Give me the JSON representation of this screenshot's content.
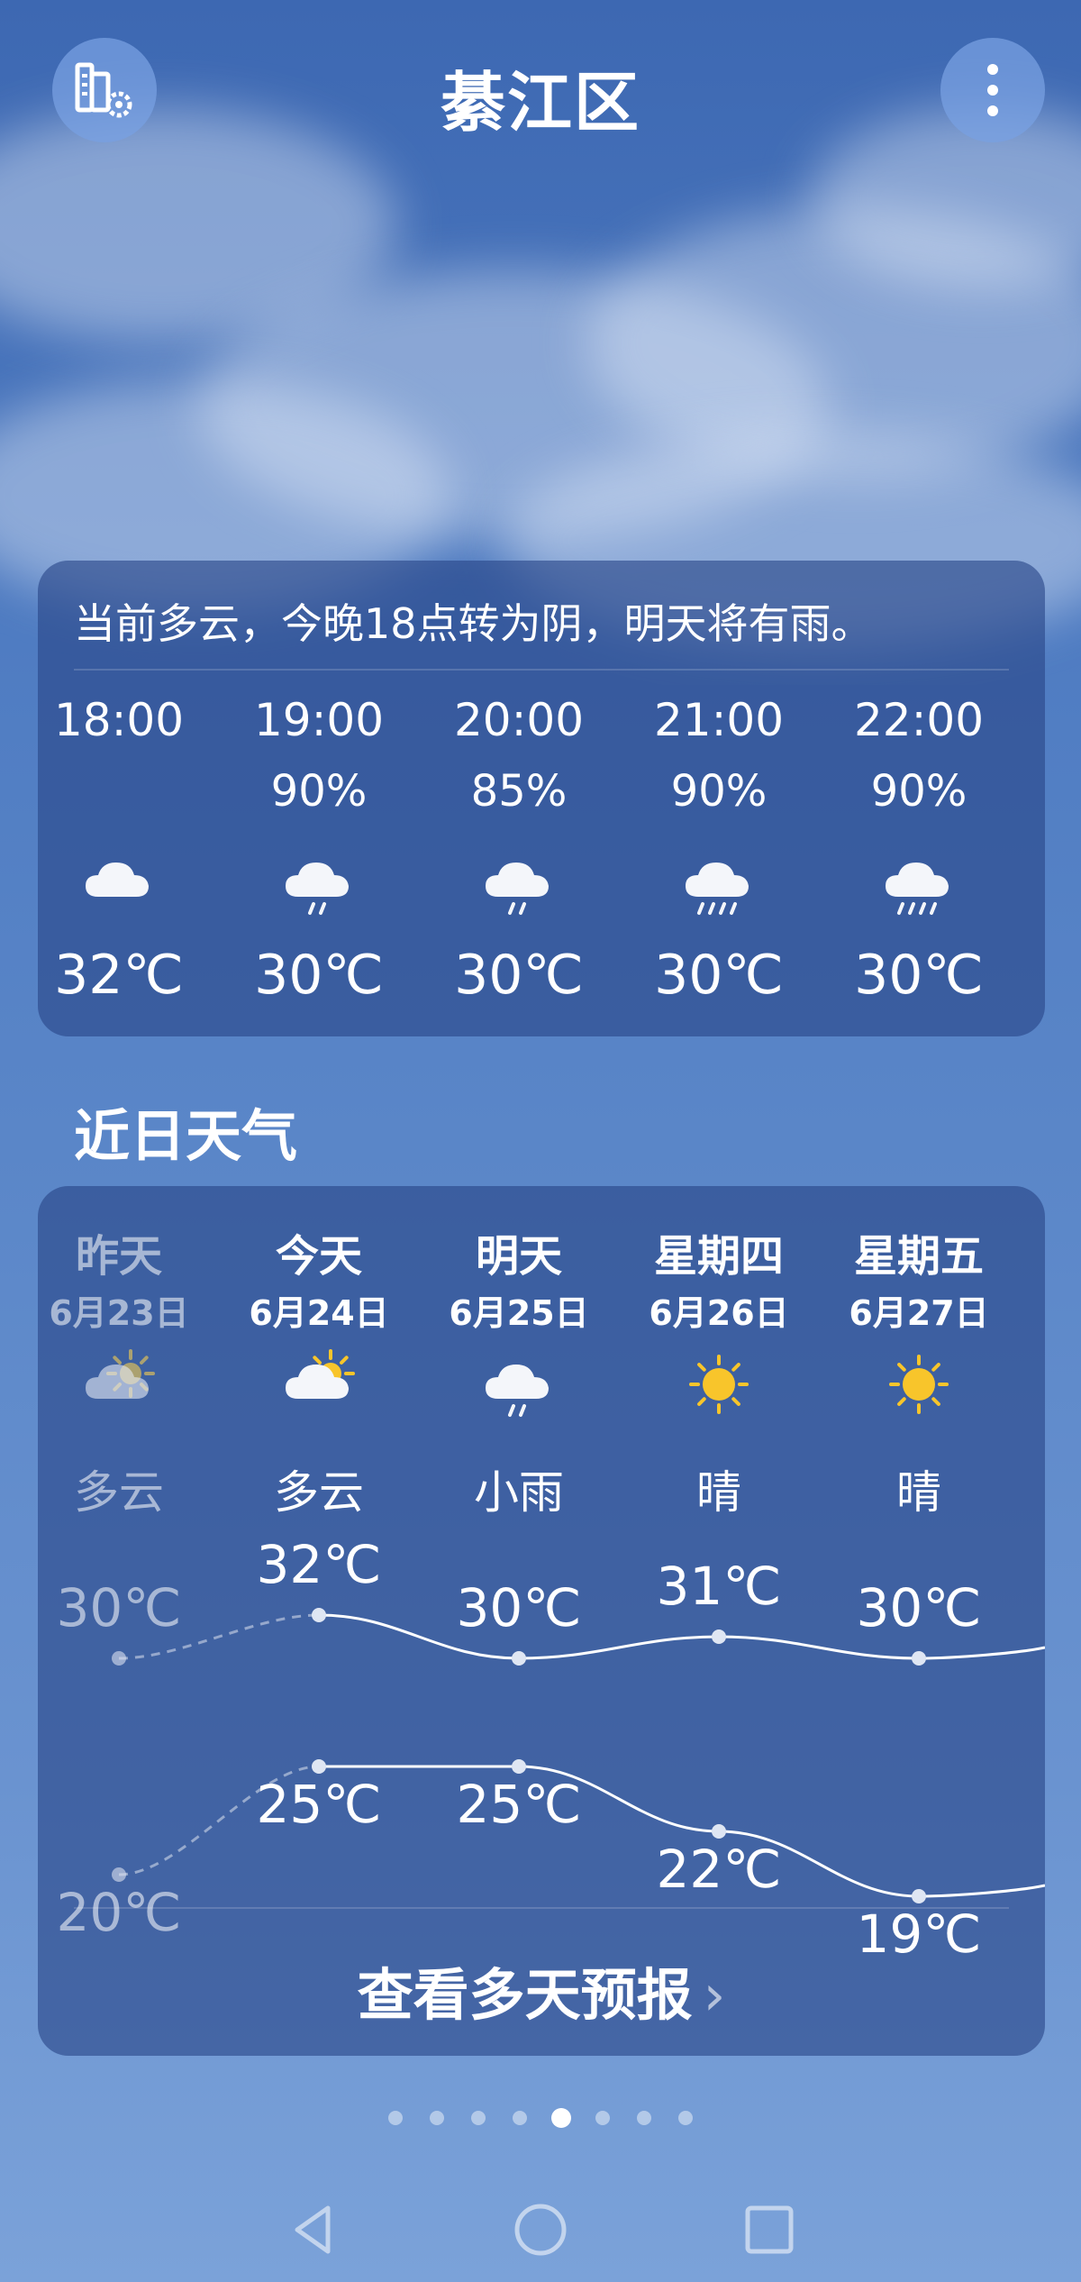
{
  "header": {
    "city": "綦江区",
    "manage_icon": "city-manage-icon",
    "more_icon": "more-vertical-icon"
  },
  "summary": {
    "text": "当前多云，今晚18点转为阴，明天将有雨。"
  },
  "hourly": [
    {
      "time": "18:00",
      "pop": "",
      "icon": "cloudy-icon",
      "temp": "32℃"
    },
    {
      "time": "19:00",
      "pop": "90%",
      "icon": "light-rain-icon",
      "temp": "30℃"
    },
    {
      "time": "20:00",
      "pop": "85%",
      "icon": "light-rain-icon",
      "temp": "30℃"
    },
    {
      "time": "21:00",
      "pop": "90%",
      "icon": "moderate-rain-icon",
      "temp": "30℃"
    },
    {
      "time": "22:00",
      "pop": "90%",
      "icon": "moderate-rain-icon",
      "temp": "30℃"
    }
  ],
  "recent": {
    "title": "近日天气",
    "days": [
      {
        "name": "昨天",
        "date": "6月23日",
        "icon": "partly-cloudy-icon",
        "cond": "多云",
        "high": "30℃",
        "low": "20℃",
        "high_val": 30,
        "low_val": 20
      },
      {
        "name": "今天",
        "date": "6月24日",
        "icon": "partly-cloudy-icon",
        "cond": "多云",
        "high": "32℃",
        "low": "25℃",
        "high_val": 32,
        "low_val": 25
      },
      {
        "name": "明天",
        "date": "6月25日",
        "icon": "light-rain-icon",
        "cond": "小雨",
        "high": "30℃",
        "low": "25℃",
        "high_val": 30,
        "low_val": 25
      },
      {
        "name": "星期四",
        "date": "6月26日",
        "icon": "sunny-icon",
        "cond": "晴",
        "high": "31℃",
        "low": "22℃",
        "high_val": 31,
        "low_val": 22
      },
      {
        "name": "星期五",
        "date": "6月27日",
        "icon": "sunny-icon",
        "cond": "晴",
        "high": "30℃",
        "low": "19℃",
        "high_val": 30,
        "low_val": 19
      }
    ],
    "more_label": "查看多天预报"
  },
  "pager": {
    "count": 8,
    "active_index": 4
  },
  "nav": {
    "back_icon": "back-triangle-icon",
    "home_icon": "home-circle-icon",
    "recents_icon": "recents-square-icon"
  }
}
